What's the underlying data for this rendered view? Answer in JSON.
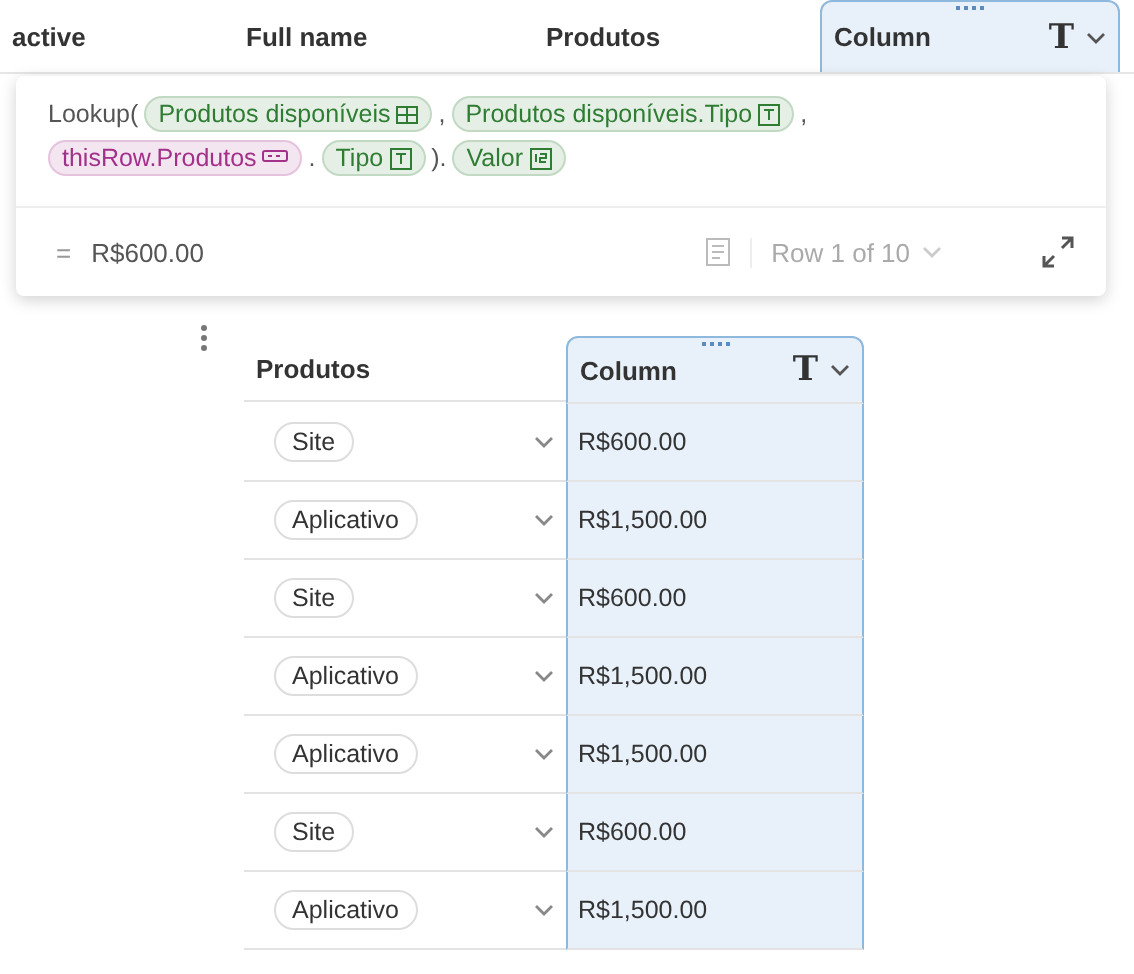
{
  "back_table": {
    "columns": [
      {
        "label": "active",
        "kind": "plain"
      },
      {
        "label": "Full name",
        "kind": "plain"
      },
      {
        "label": "Produtos",
        "kind": "plain"
      },
      {
        "label": "Column",
        "kind": "selected",
        "type_glyph": "T"
      }
    ]
  },
  "formula_popup": {
    "lines": [
      [
        {
          "kind": "text",
          "text": "Lookup("
        },
        {
          "kind": "table_chip",
          "text": "Produtos disponíveis",
          "color": "#2e7d32"
        },
        {
          "kind": "text",
          "text": ","
        },
        {
          "kind": "text_chip",
          "text": "Produtos disponíveis.Tipo",
          "color": "#2e7d32"
        },
        {
          "kind": "text",
          "text": ","
        }
      ],
      [
        {
          "kind": "list_chip",
          "text": "thisRow.Produtos",
          "color": "#a3318a"
        },
        {
          "kind": "text",
          "text": "."
        },
        {
          "kind": "text_chip",
          "text": "Tipo",
          "color": "#2e7d32"
        },
        {
          "kind": "text",
          "text": ")."
        },
        {
          "kind": "number_chip",
          "text": "Valor",
          "color": "#2e7d32"
        }
      ]
    ],
    "equals": "=",
    "result": "R$600.00",
    "row_indicator": "Row 1 of 10"
  },
  "table": {
    "columns": [
      {
        "label": "Produtos",
        "kind": "plain"
      },
      {
        "label": "Column",
        "kind": "selected",
        "type_glyph": "T"
      }
    ],
    "rows": [
      {
        "produto": "Site",
        "value": "R$600.00"
      },
      {
        "produto": "Aplicativo",
        "value": "R$1,500.00"
      },
      {
        "produto": "Site",
        "value": "R$600.00"
      },
      {
        "produto": "Aplicativo",
        "value": "R$1,500.00"
      },
      {
        "produto": "Aplicativo",
        "value": "R$1,500.00"
      },
      {
        "produto": "Site",
        "value": "R$600.00"
      },
      {
        "produto": "Aplicativo",
        "value": "R$1,500.00"
      }
    ]
  }
}
